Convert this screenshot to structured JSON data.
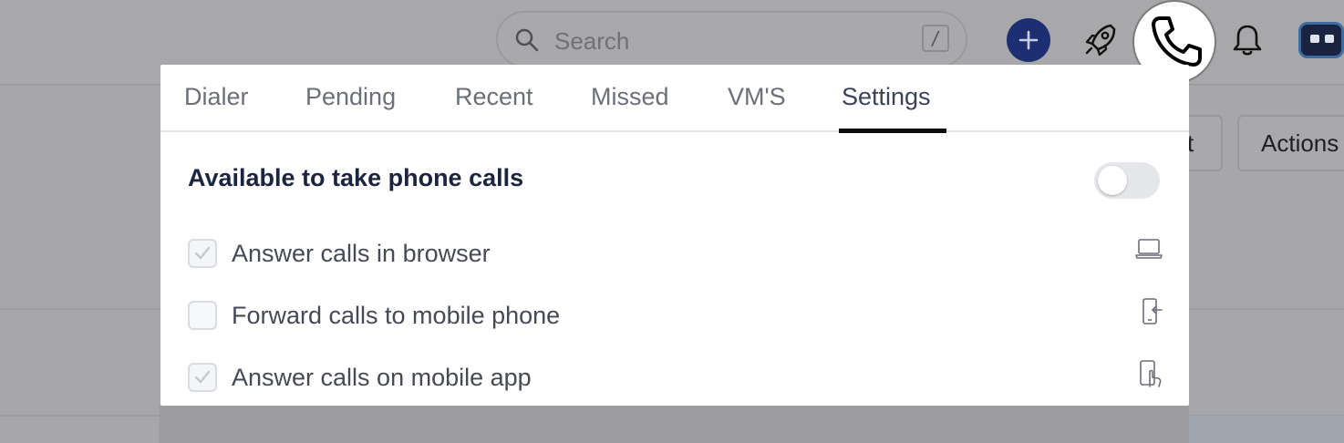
{
  "header": {
    "search": {
      "placeholder": "Search",
      "shortcut": "/"
    },
    "icons": {
      "search": "search-icon",
      "add": "plus-icon",
      "whats_new": "rocket-icon",
      "phone": "phone-icon",
      "notifications": "bell-icon",
      "avatar": "robot-avatar"
    }
  },
  "background": {
    "buttons": [
      {
        "label": "t"
      },
      {
        "label": "Actions"
      }
    ]
  },
  "dialer_popover": {
    "tabs": [
      {
        "label": "Dialer",
        "active": false
      },
      {
        "label": "Pending",
        "active": false
      },
      {
        "label": "Recent",
        "active": false
      },
      {
        "label": "Missed",
        "active": false
      },
      {
        "label": "VM'S",
        "active": false
      },
      {
        "label": "Settings",
        "active": true
      }
    ],
    "availability": {
      "label": "Available to take phone calls",
      "enabled": false
    },
    "options": [
      {
        "label": "Answer calls in browser",
        "checked": true,
        "icon": "laptop-icon"
      },
      {
        "label": "Forward calls to mobile phone",
        "checked": false,
        "icon": "mobile-forward-icon"
      },
      {
        "label": "Answer calls on mobile app",
        "checked": true,
        "icon": "mobile-tap-icon"
      }
    ]
  },
  "colors": {
    "overlay": "#a7a7a9",
    "primary_button": "#1d2f72",
    "heading_text": "#1c2540",
    "tab_active_underline": "#0d0d10",
    "toggle_off": "#e4e6ea"
  }
}
